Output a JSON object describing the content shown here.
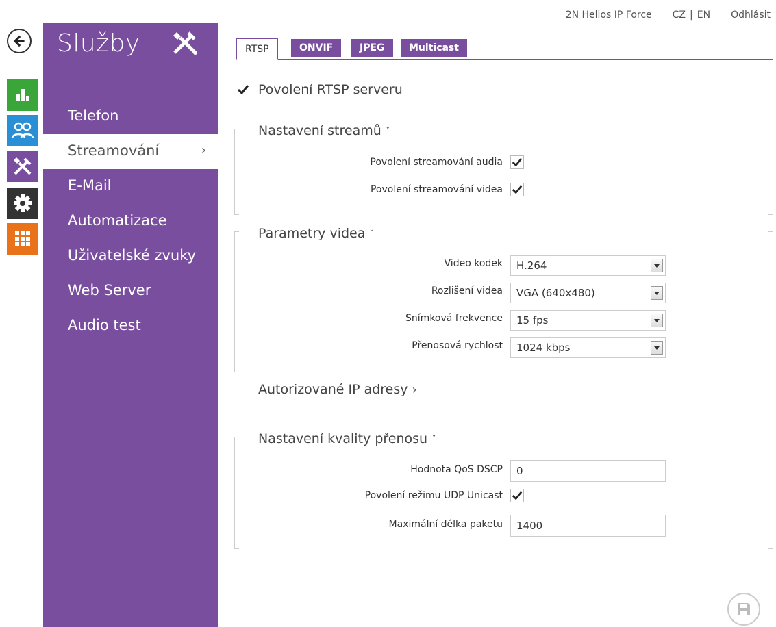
{
  "header": {
    "device_name": "2N Helios IP Force",
    "lang_cz": "CZ",
    "lang_sep": "|",
    "lang_en": "EN",
    "logout": "Odhlásit"
  },
  "rail": {
    "icons": [
      "back-arrow-icon",
      "status-chart-icon",
      "users-icon",
      "services-tools-icon",
      "settings-gear-icon",
      "apps-grid-icon"
    ],
    "colors": {
      "status": "#3aa538",
      "users": "#2b8fd6",
      "services": "#7a4e9e",
      "settings": "#333333",
      "apps": "#e8731a"
    }
  },
  "sidebar": {
    "title": "Služby",
    "title_icon": "tools-icon",
    "color": "#7a4e9e",
    "items": [
      {
        "label": "Telefon"
      },
      {
        "label": "Streamování",
        "active": true,
        "chevron": "›"
      },
      {
        "label": "E-Mail"
      },
      {
        "label": "Automatizace"
      },
      {
        "label": "Uživatelské zvuky"
      },
      {
        "label": "Web Server"
      },
      {
        "label": "Audio test"
      }
    ]
  },
  "tabs": [
    {
      "label": "RTSP",
      "active": true
    },
    {
      "label": "ONVIF"
    },
    {
      "label": "JPEG"
    },
    {
      "label": "Multicast"
    }
  ],
  "main": {
    "enable_rtsp_label": "Povolení RTSP serveru",
    "enable_rtsp_checked": true,
    "stream_section": {
      "title": "Nastavení streamů",
      "arrow": "ˇ",
      "audio_label": "Povolení streamování audia",
      "audio_checked": true,
      "video_label": "Povolení streamování videa",
      "video_checked": true
    },
    "video_section": {
      "title": "Parametry videa",
      "arrow": "ˇ",
      "codec_label": "Video kodek",
      "codec_value": "H.264",
      "resolution_label": "Rozlišení videa",
      "resolution_value": "VGA (640x480)",
      "fps_label": "Snímková frekvence",
      "fps_value": "15 fps",
      "bitrate_label": "Přenosová rychlost",
      "bitrate_value": "1024 kbps"
    },
    "ip_section": {
      "title": "Autorizované IP adresy",
      "arrow": "›"
    },
    "quality_section": {
      "title": "Nastavení kvality přenosu",
      "arrow": "ˇ",
      "qos_label": "Hodnota QoS DSCP",
      "qos_value": "0",
      "udp_label": "Povolení režimu UDP Unicast",
      "udp_checked": true,
      "packet_label": "Maximální délka paketu",
      "packet_value": "1400"
    }
  },
  "footer": {
    "save_icon": "save-disk-icon"
  }
}
